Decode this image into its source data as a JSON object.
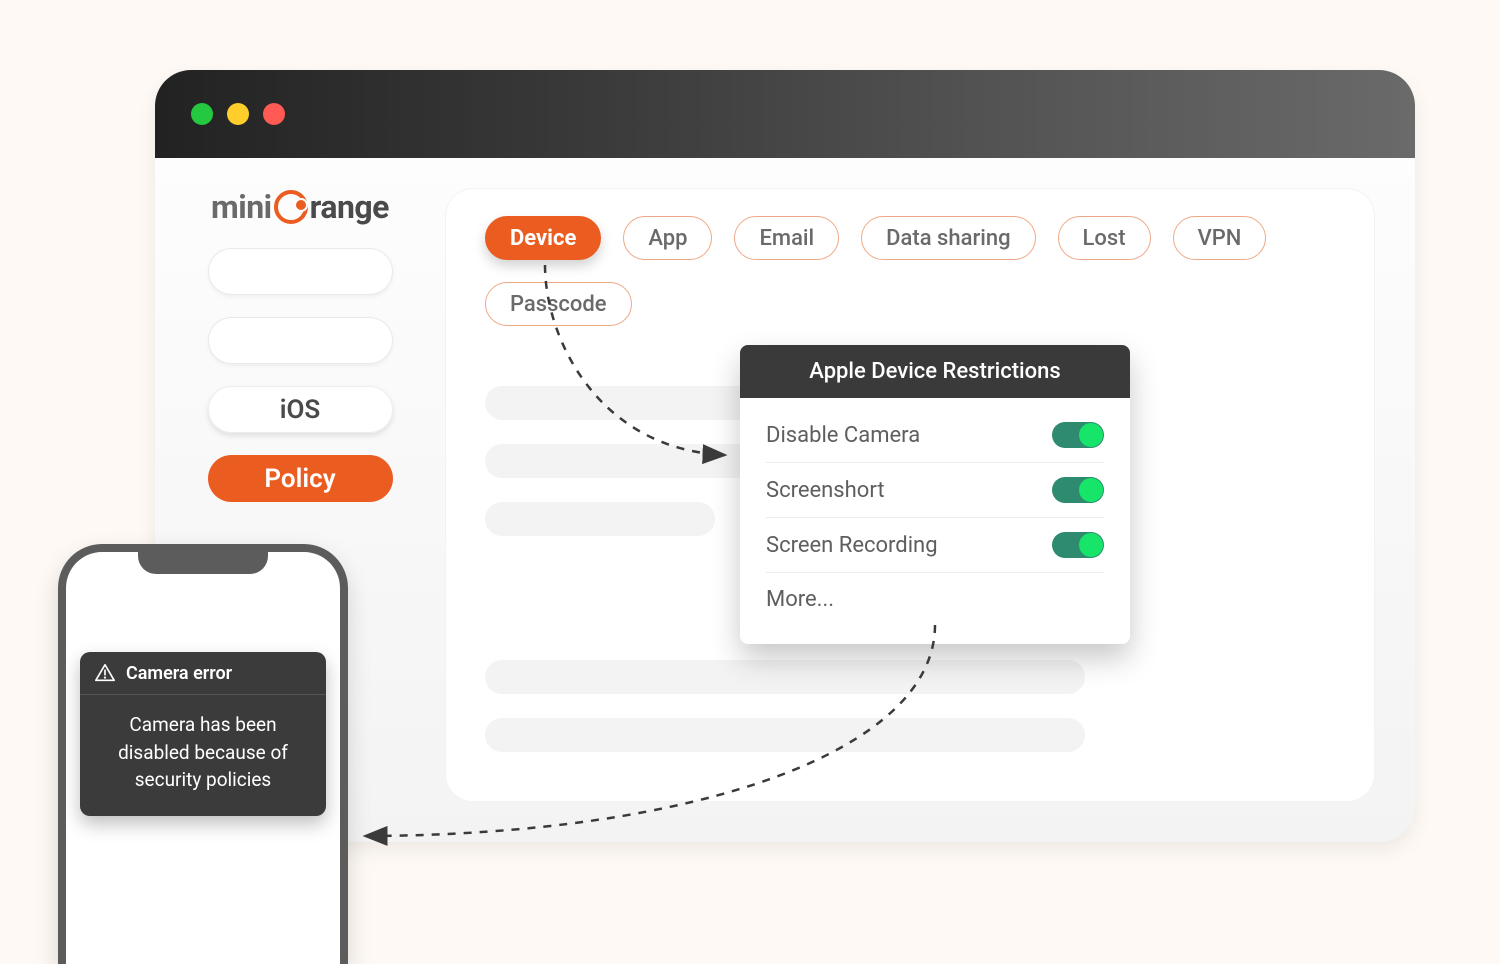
{
  "brand": {
    "name_prefix": "mini",
    "name_suffix": "range"
  },
  "sidebar": {
    "ios_label": "iOS",
    "policy_label": "Policy"
  },
  "tabs": [
    {
      "label": "Device",
      "active": true
    },
    {
      "label": "App",
      "active": false
    },
    {
      "label": "Email",
      "active": false
    },
    {
      "label": "Data sharing",
      "active": false
    },
    {
      "label": "Lost",
      "active": false
    },
    {
      "label": "VPN",
      "active": false
    },
    {
      "label": "Passcode",
      "active": false
    }
  ],
  "restrictions": {
    "title": "Apple Device Restrictions",
    "items": [
      {
        "label": "Disable Camera",
        "enabled": true
      },
      {
        "label": "Screenshort",
        "enabled": true
      },
      {
        "label": "Screen Recording",
        "enabled": true
      }
    ],
    "more_label": "More..."
  },
  "phone_error": {
    "title": "Camera error",
    "body": "Camera has been disabled because of security policies"
  },
  "colors": {
    "accent": "#EB5C20",
    "toggle_track": "#2E8B6F",
    "toggle_knob": "#17E56A"
  }
}
